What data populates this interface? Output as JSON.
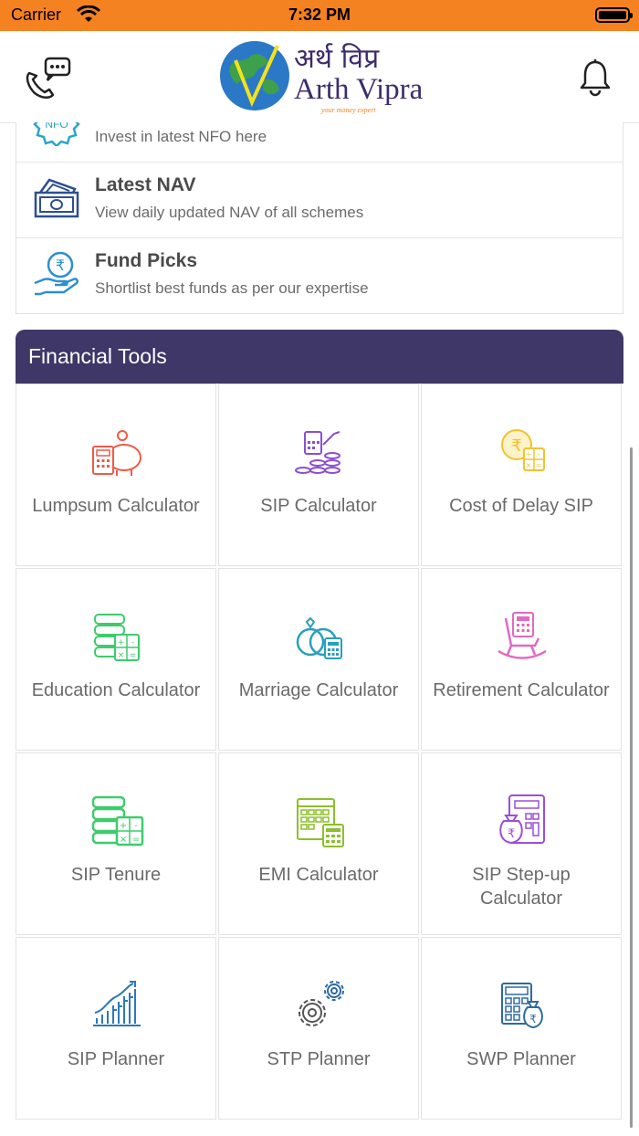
{
  "status_bar": {
    "carrier": "Carrier",
    "time": "7:32 PM"
  },
  "header": {
    "logo_hindi": "अर्थ विप्र",
    "logo_english": "Arth Vipra",
    "logo_tagline": "your money expert",
    "call_icon": "phone-chat-icon",
    "bell_icon": "bell-icon"
  },
  "menu": {
    "items": [
      {
        "title": "",
        "subtitle": "Invest in latest NFO here",
        "icon": "nfo-badge-icon"
      },
      {
        "title": "Latest NAV",
        "subtitle": "View daily updated NAV of all schemes",
        "icon": "banknotes-icon"
      },
      {
        "title": "Fund Picks",
        "subtitle": "Shortlist best funds as per our expertise",
        "icon": "rupee-hand-icon"
      }
    ]
  },
  "tools": {
    "heading": "Financial Tools",
    "items": [
      {
        "label": "Lumpsum Calculator",
        "icon": "piggy-bank-calculator-icon",
        "color": "#ef5a47"
      },
      {
        "label": "SIP Calculator",
        "icon": "coins-growth-calculator-icon",
        "color": "#8a4fd0"
      },
      {
        "label": "Cost of Delay SIP",
        "icon": "rupee-coin-calculator-icon",
        "color": "#f2c230"
      },
      {
        "label": "Education Calculator",
        "icon": "books-calculator-icon",
        "color": "#3fcb6c"
      },
      {
        "label": "Marriage Calculator",
        "icon": "rings-calculator-icon",
        "color": "#2a9fbd"
      },
      {
        "label": "Retirement Calculator",
        "icon": "rocking-chair-calculator-icon",
        "color": "#e26ac0"
      },
      {
        "label": "SIP Tenure",
        "icon": "books-calculator-icon",
        "color": "#3fcb6c"
      },
      {
        "label": "EMI Calculator",
        "icon": "calendar-calculator-icon",
        "color": "#8cbf2c"
      },
      {
        "label": "SIP Step-up Calculator",
        "icon": "money-bag-calculator-icon",
        "color": "#9b4fd8"
      },
      {
        "label": "SIP Planner",
        "icon": "growth-bars-icon",
        "color": "#2d78b8"
      },
      {
        "label": "STP Planner",
        "icon": "gears-icon",
        "color": "#555555"
      },
      {
        "label": "SWP Planner",
        "icon": "calculator-rupee-bag-icon",
        "color": "#2d6aa0"
      }
    ]
  },
  "colors": {
    "status_bar": "#f58220",
    "tools_header": "#3e3768"
  }
}
